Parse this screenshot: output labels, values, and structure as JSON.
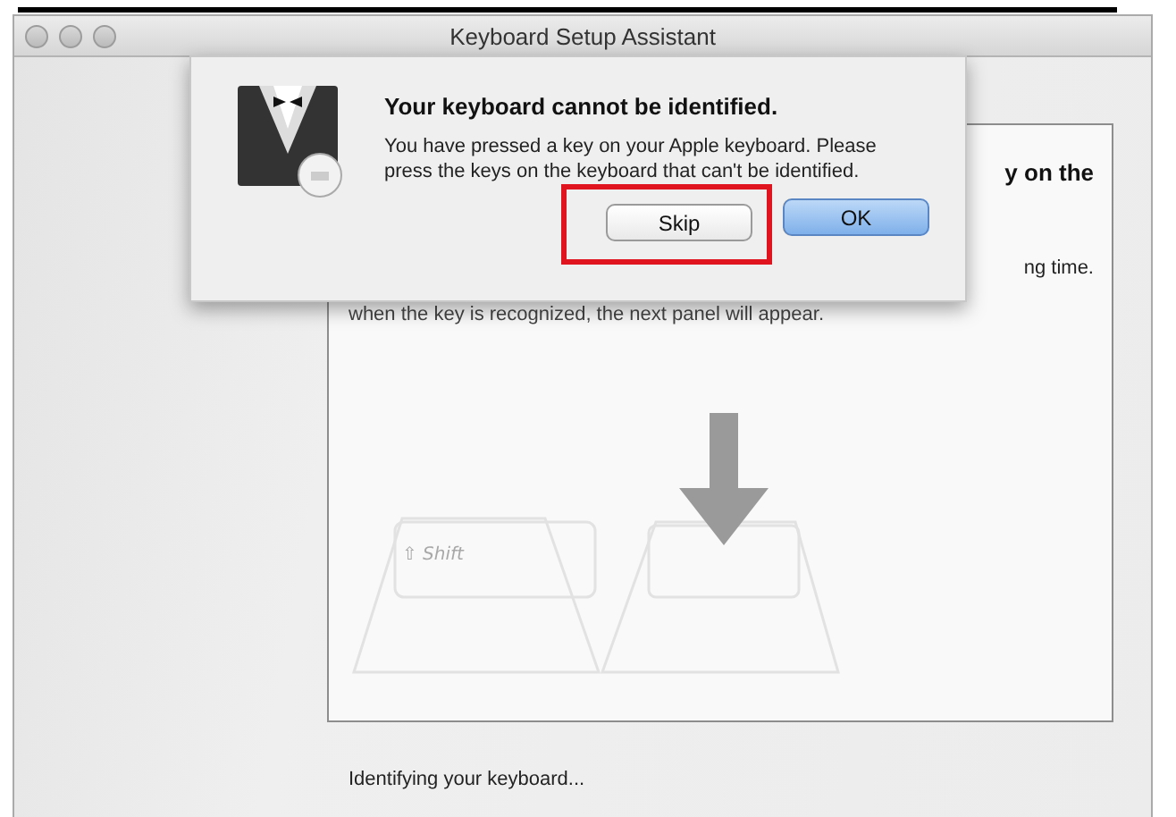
{
  "window": {
    "title": "Keyboard Setup Assistant"
  },
  "panel": {
    "heading_fragment": "y on the",
    "instruction_fragment": "ng time.",
    "note": "when the key is recognized, the next panel will appear.",
    "key_label": "⇧ Shift"
  },
  "status": "Identifying your keyboard...",
  "dialog": {
    "title": "Your keyboard cannot be identified.",
    "message": "You have pressed a key on your Apple keyboard. Please press the keys on the keyboard that can't be identified.",
    "buttons": [
      {
        "label": "Skip",
        "default": false,
        "highlighted": true
      },
      {
        "label": "OK",
        "default": true,
        "highlighted": false
      }
    ]
  }
}
